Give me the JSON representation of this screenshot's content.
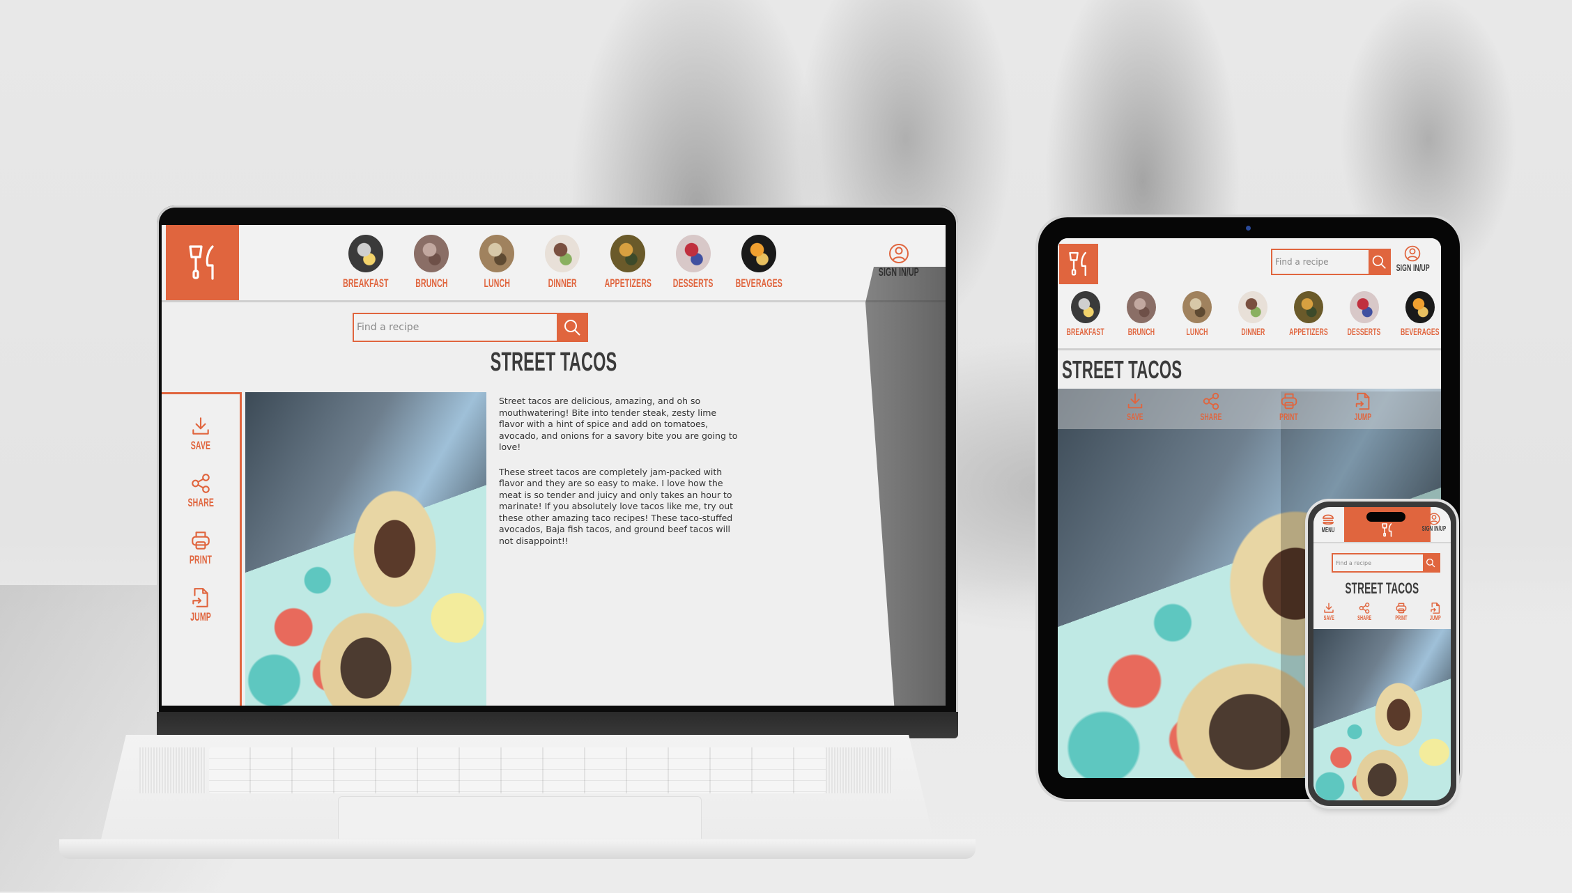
{
  "site": {
    "brand_color": "#e0653e",
    "text_dark": "#3b3b3b",
    "logo_icon": "spatula-and-knife-icon",
    "categories": [
      {
        "label": "BREAKFAST",
        "thumb_colors": [
          "#3a3a3a",
          "#cfcfcf",
          "#f2d36b"
        ]
      },
      {
        "label": "BRUNCH",
        "thumb_colors": [
          "#8a6e66",
          "#c2a8a0",
          "#6e5048"
        ]
      },
      {
        "label": "LUNCH",
        "thumb_colors": [
          "#a0825e",
          "#d7c8a8",
          "#5e4a32"
        ]
      },
      {
        "label": "DINNER",
        "thumb_colors": [
          "#e8e0d8",
          "#7a5040",
          "#8ab060"
        ]
      },
      {
        "label": "APPETIZERS",
        "thumb_colors": [
          "#6a5a2a",
          "#d8a040",
          "#3c4a2a"
        ]
      },
      {
        "label": "DESSERTS",
        "thumb_colors": [
          "#d8c8c8",
          "#c0303e",
          "#4050a0"
        ]
      },
      {
        "label": "BEVERAGES",
        "thumb_colors": [
          "#1a1a1a",
          "#f0a030",
          "#e8c060"
        ]
      }
    ],
    "sign_in_label": "SIGN IN/UP",
    "menu_label": "MENU",
    "search_placeholder": "Find a recipe",
    "recipe_title": "STREET TACOS",
    "actions": [
      {
        "label": "SAVE",
        "icon": "download-icon"
      },
      {
        "label": "SHARE",
        "icon": "share-icon"
      },
      {
        "label": "PRINT",
        "icon": "printer-icon"
      },
      {
        "label": "JUMP",
        "icon": "jump-file-icon"
      }
    ],
    "description": [
      "Street tacos are delicious, amazing, and oh so mouthwatering! Bite into tender steak, zesty lime flavor with a hint of spice and add on tomatoes, avocado, and onions for a savory bite you are going to love!",
      "These street tacos are completely jam-packed with flavor and they are so easy to make. I love how the meat is so tender and juicy and only takes an hour to marinate! If you absolutely love tacos like me, try out these other amazing taco recipes! These taco-stuffed avocados, Baja fish tacos, and ground beef tacos will not disappoint!!"
    ]
  }
}
